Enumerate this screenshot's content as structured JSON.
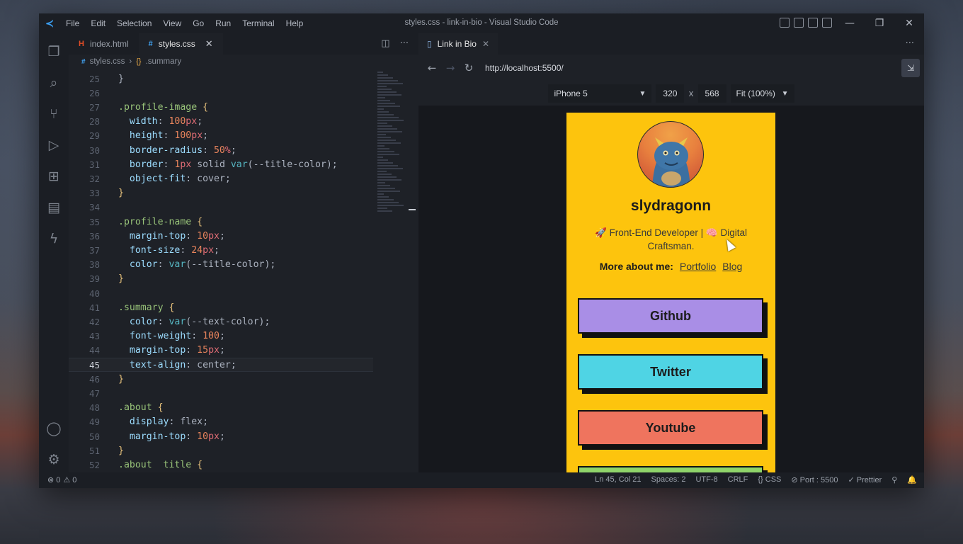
{
  "window": {
    "title": "styles.css - link-in-bio - Visual Studio Code",
    "menu": [
      "File",
      "Edit",
      "Selection",
      "View",
      "Go",
      "Run",
      "Terminal",
      "Help"
    ],
    "controls": {
      "minimize": "—",
      "restore": "❐",
      "close": "✕"
    }
  },
  "activity_bar": {
    "items": [
      "files-icon",
      "search-icon",
      "source-control-icon",
      "run-debug-icon",
      "extensions-icon",
      "notebook-icon",
      "lightning-icon"
    ],
    "bottom": [
      "account-icon",
      "settings-gear-icon"
    ]
  },
  "editor": {
    "tabs": [
      {
        "label": "index.html",
        "icon": "H"
      },
      {
        "label": "styles.css",
        "icon": "#",
        "active": true,
        "close": "✕"
      }
    ],
    "actions": {
      "split": "◫",
      "more": "···"
    },
    "breadcrumb": {
      "file": "styles.css",
      "sep": "›",
      "symbol": ".summary",
      "symbol_icon": "{}"
    },
    "lines": [
      {
        "n": "25",
        "tokens": [
          [
            "}",
            "punc"
          ]
        ]
      },
      {
        "n": "26",
        "tokens": []
      },
      {
        "n": "27",
        "tokens": [
          [
            ".profile-image ",
            "sel"
          ],
          [
            "{",
            "brace"
          ]
        ]
      },
      {
        "n": "28",
        "tokens": [
          [
            "  width",
            "prop"
          ],
          [
            ": ",
            "punc"
          ],
          [
            "100",
            "num"
          ],
          [
            "px",
            "unit"
          ],
          [
            ";",
            "punc"
          ]
        ]
      },
      {
        "n": "29",
        "tokens": [
          [
            "  height",
            "prop"
          ],
          [
            ": ",
            "punc"
          ],
          [
            "100",
            "num"
          ],
          [
            "px",
            "unit"
          ],
          [
            ";",
            "punc"
          ]
        ]
      },
      {
        "n": "30",
        "tokens": [
          [
            "  border-radius",
            "prop"
          ],
          [
            ": ",
            "punc"
          ],
          [
            "50",
            "num"
          ],
          [
            "%",
            "unit"
          ],
          [
            ";",
            "punc"
          ]
        ]
      },
      {
        "n": "31",
        "tokens": [
          [
            "  border",
            "prop"
          ],
          [
            ": ",
            "punc"
          ],
          [
            "1",
            "num"
          ],
          [
            "px",
            "unit"
          ],
          [
            " solid ",
            "punc"
          ],
          [
            "var",
            "kw"
          ],
          [
            "(--title-color);",
            "var"
          ]
        ]
      },
      {
        "n": "32",
        "tokens": [
          [
            "  object-fit",
            "prop"
          ],
          [
            ": ",
            "punc"
          ],
          [
            "cover",
            "punc"
          ],
          [
            ";",
            "punc"
          ]
        ]
      },
      {
        "n": "33",
        "tokens": [
          [
            "}",
            "brace"
          ]
        ]
      },
      {
        "n": "34",
        "tokens": []
      },
      {
        "n": "35",
        "tokens": [
          [
            ".profile-name ",
            "sel"
          ],
          [
            "{",
            "brace"
          ]
        ]
      },
      {
        "n": "36",
        "tokens": [
          [
            "  margin-top",
            "prop"
          ],
          [
            ": ",
            "punc"
          ],
          [
            "10",
            "num"
          ],
          [
            "px",
            "unit"
          ],
          [
            ";",
            "punc"
          ]
        ]
      },
      {
        "n": "37",
        "tokens": [
          [
            "  font-size",
            "prop"
          ],
          [
            ": ",
            "punc"
          ],
          [
            "24",
            "num"
          ],
          [
            "px",
            "unit"
          ],
          [
            ";",
            "punc"
          ]
        ]
      },
      {
        "n": "38",
        "tokens": [
          [
            "  color",
            "prop"
          ],
          [
            ": ",
            "punc"
          ],
          [
            "var",
            "kw"
          ],
          [
            "(--title-color);",
            "var"
          ]
        ]
      },
      {
        "n": "39",
        "tokens": [
          [
            "}",
            "brace"
          ]
        ]
      },
      {
        "n": "40",
        "tokens": []
      },
      {
        "n": "41",
        "tokens": [
          [
            ".summary ",
            "sel"
          ],
          [
            "{",
            "brace"
          ]
        ]
      },
      {
        "n": "42",
        "tokens": [
          [
            "  color",
            "prop"
          ],
          [
            ": ",
            "punc"
          ],
          [
            "var",
            "kw"
          ],
          [
            "(--text-color);",
            "var"
          ]
        ]
      },
      {
        "n": "43",
        "tokens": [
          [
            "  font-weight",
            "prop"
          ],
          [
            ": ",
            "punc"
          ],
          [
            "100",
            "num"
          ],
          [
            ";",
            "punc"
          ]
        ]
      },
      {
        "n": "44",
        "tokens": [
          [
            "  margin-top",
            "prop"
          ],
          [
            ": ",
            "punc"
          ],
          [
            "15",
            "num"
          ],
          [
            "px",
            "unit"
          ],
          [
            ";",
            "punc"
          ]
        ]
      },
      {
        "n": "45",
        "tokens": [
          [
            "  text-align",
            "prop"
          ],
          [
            ": ",
            "punc"
          ],
          [
            "center",
            "punc"
          ],
          [
            ";",
            "punc"
          ]
        ],
        "current": true
      },
      {
        "n": "46",
        "tokens": [
          [
            "}",
            "brace"
          ]
        ]
      },
      {
        "n": "47",
        "tokens": []
      },
      {
        "n": "48",
        "tokens": [
          [
            ".about ",
            "sel"
          ],
          [
            "{",
            "brace"
          ]
        ]
      },
      {
        "n": "49",
        "tokens": [
          [
            "  display",
            "prop"
          ],
          [
            ": ",
            "punc"
          ],
          [
            "flex",
            "punc"
          ],
          [
            ";",
            "punc"
          ]
        ]
      },
      {
        "n": "50",
        "tokens": [
          [
            "  margin-top",
            "prop"
          ],
          [
            ": ",
            "punc"
          ],
          [
            "10",
            "num"
          ],
          [
            "px",
            "unit"
          ],
          [
            ";",
            "punc"
          ]
        ]
      },
      {
        "n": "51",
        "tokens": [
          [
            "}",
            "brace"
          ]
        ]
      },
      {
        "n": "52",
        "tokens": [
          [
            ".about  title ",
            "sel"
          ],
          [
            "{",
            "brace"
          ]
        ]
      }
    ]
  },
  "preview": {
    "tab": {
      "label": "Link in Bio",
      "close": "✕"
    },
    "more": "···",
    "nav": {
      "back": "←",
      "forward": "→",
      "reload": "↻"
    },
    "url": "http://localhost:5500/",
    "device": {
      "name": "iPhone 5",
      "width": "320",
      "x": "x",
      "height": "568",
      "zoom": "Fit (100%)"
    },
    "page": {
      "name": "slydragonn",
      "summary_rocket": "🚀",
      "summary_text_1": "Front-End Developer |",
      "summary_brain": "🧠",
      "summary_text_2": "Digital Craftsman.",
      "about_title": "More about me:",
      "about_links": [
        "Portfolio",
        "Blog"
      ],
      "buttons": [
        {
          "label": "Github",
          "color": "#a98ee6"
        },
        {
          "label": "Twitter",
          "color": "#4fd4e4"
        },
        {
          "label": "Youtube",
          "color": "#ef745e"
        },
        {
          "label": "",
          "color": "#8fd46a"
        }
      ],
      "background": "#fdc40d"
    }
  },
  "status_bar": {
    "errors": "⊗ 0",
    "warnings": "⚠ 0",
    "items": [
      "Ln 45, Col 21",
      "Spaces: 2",
      "UTF-8",
      "CRLF",
      "{} CSS",
      "⊘ Port : 5500",
      "✓ Prettier",
      "⚲",
      "🔔"
    ]
  }
}
